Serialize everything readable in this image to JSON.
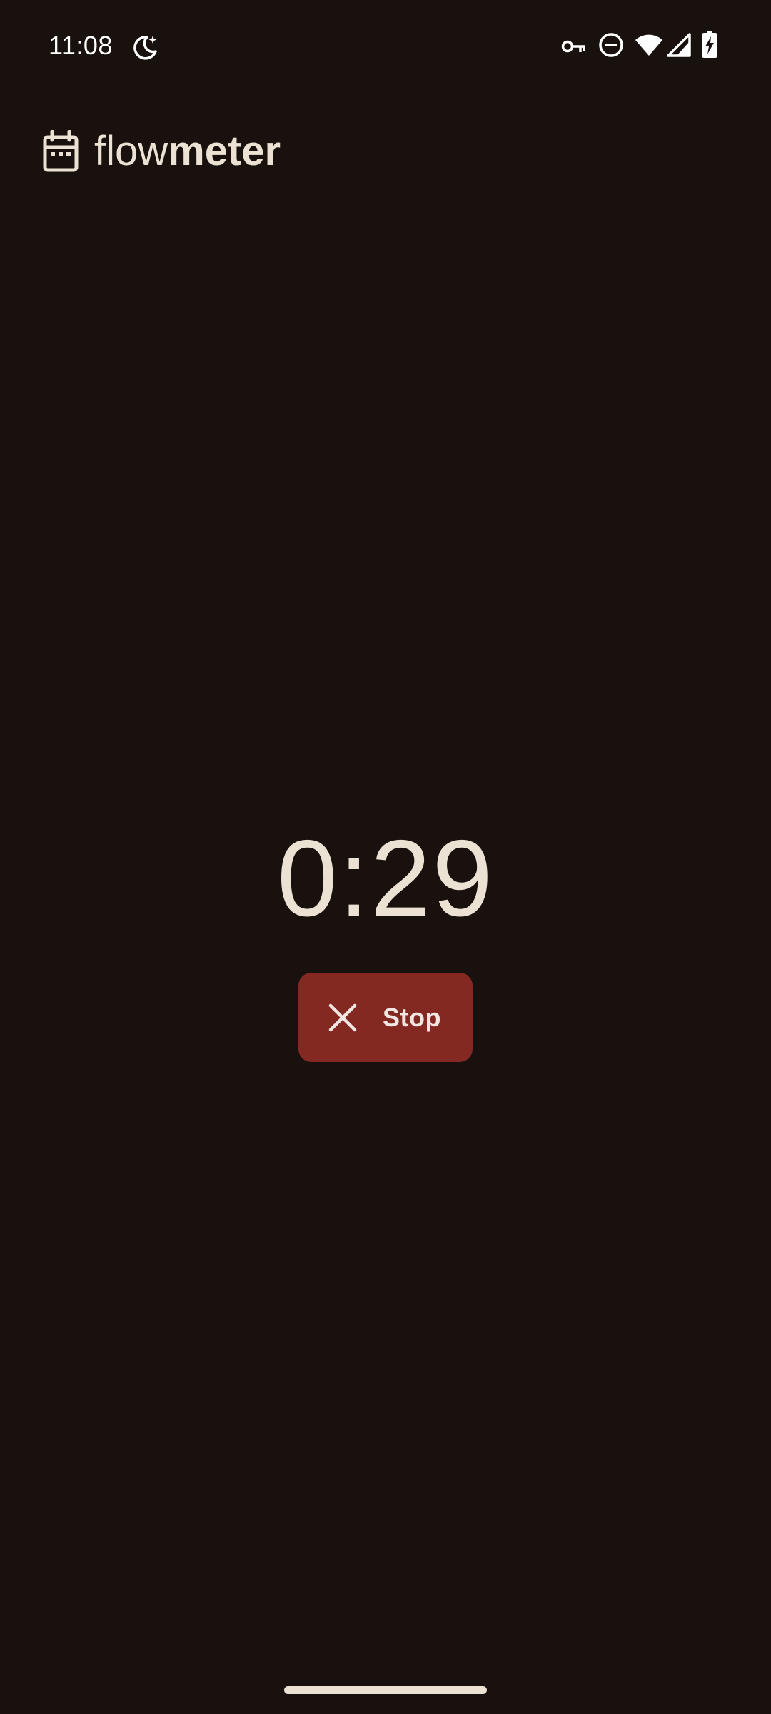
{
  "status_bar": {
    "time": "11:08",
    "icons": [
      "night-mode-icon",
      "vpn-key-icon",
      "do-not-disturb-icon",
      "wifi-icon",
      "cell-signal-icon",
      "battery-charging-icon"
    ]
  },
  "header": {
    "title_light": "flow",
    "title_bold": "meter",
    "logo_icon": "calendar-icon"
  },
  "timer": {
    "value": "0:29"
  },
  "stop_button": {
    "label": "Stop",
    "icon": "close-icon",
    "color": "#842822"
  },
  "colors": {
    "background": "#19110d",
    "text": "#ece2d4",
    "accent": "#842822"
  }
}
